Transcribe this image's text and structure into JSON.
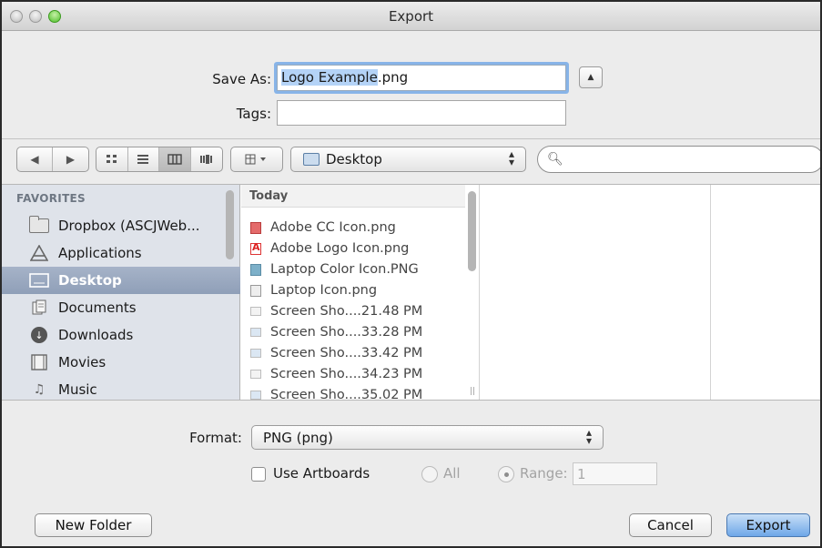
{
  "window": {
    "title": "Export"
  },
  "save": {
    "save_as_label": "Save As:",
    "filename_selected": "Logo Example",
    "filename_ext": ".png",
    "tags_label": "Tags:",
    "tags_value": ""
  },
  "toolbar": {
    "view_modes": [
      "icon-view",
      "list-view",
      "column-view",
      "coverflow-view"
    ],
    "active_view": "column-view",
    "location": "Desktop",
    "search_placeholder": ""
  },
  "sidebar": {
    "header": "FAVORITES",
    "items": [
      {
        "label": "Dropbox (ASCJWeb...",
        "icon": "folder-icon"
      },
      {
        "label": "Applications",
        "icon": "applications-icon"
      },
      {
        "label": "Desktop",
        "icon": "desktop-icon",
        "selected": true
      },
      {
        "label": "Documents",
        "icon": "documents-icon"
      },
      {
        "label": "Downloads",
        "icon": "downloads-icon"
      },
      {
        "label": "Movies",
        "icon": "movies-icon"
      },
      {
        "label": "Music",
        "icon": "music-icon"
      }
    ]
  },
  "files": {
    "group_header": "Today",
    "items": [
      "Adobe CC Icon.png",
      "Adobe Logo Icon.png",
      "Laptop Color Icon.PNG",
      "Laptop Icon.png",
      "Screen Sho....21.48 PM",
      "Screen Sho....33.28 PM",
      "Screen Sho....33.42 PM",
      "Screen Sho....34.23 PM",
      "Screen Sho....35.02 PM"
    ]
  },
  "options": {
    "format_label": "Format:",
    "format_value": "PNG (png)",
    "use_artboards_label": "Use Artboards",
    "use_artboards_checked": false,
    "all_label": "All",
    "range_label": "Range:",
    "range_value": "1"
  },
  "buttons": {
    "new_folder": "New Folder",
    "cancel": "Cancel",
    "export": "Export"
  },
  "colors": {
    "selection_blue": "#88b4e8",
    "sidebar_bg": "#dfe3ea",
    "sidebar_selected": "#98a8c0",
    "default_button": "#6ea7e8"
  }
}
